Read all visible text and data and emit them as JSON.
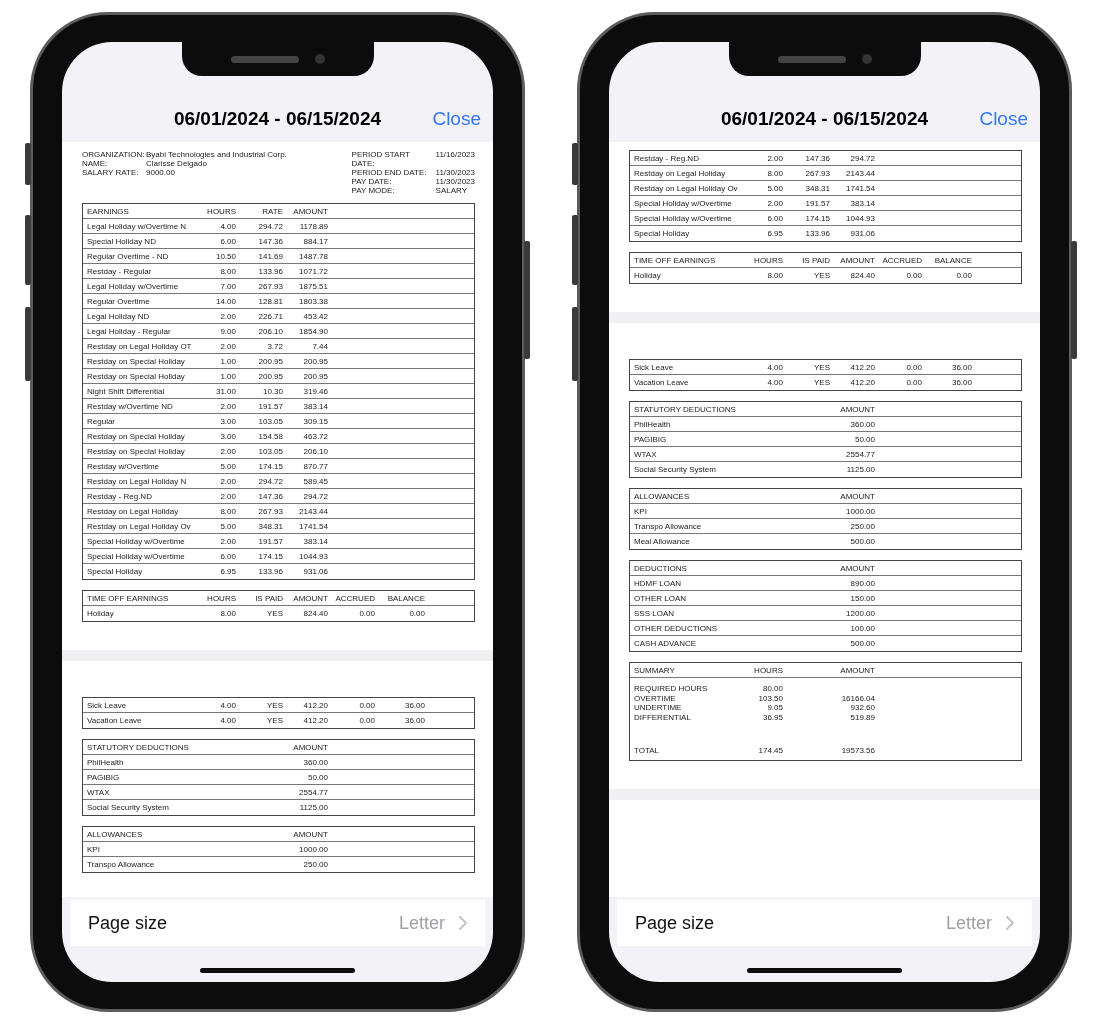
{
  "phones": [
    {
      "title": "06/01/2024 - 06/15/2024",
      "close_label": "Close",
      "page_size": {
        "label": "Page size",
        "value": "Letter"
      },
      "document": [
        {
          "kind": "info",
          "left": [
            {
              "label": "ORGANIZATION:",
              "value": "Byabi Technologies and Industrial Corp."
            },
            {
              "label": "NAME:",
              "value": "Clarisse Delgado"
            },
            {
              "label": "SALARY RATE:",
              "value": "9000.00"
            }
          ],
          "right": [
            {
              "label": "PERIOD START DATE:",
              "value": "11/16/2023"
            },
            {
              "label": "PERIOD END DATE:",
              "value": "11/30/2023"
            },
            {
              "label": "PAY DATE:",
              "value": "11/30/2023"
            },
            {
              "label": "PAY MODE:",
              "value": "SALARY"
            }
          ]
        },
        {
          "kind": "table",
          "columns": [
            "EARNINGS",
            "HOURS",
            "RATE",
            "AMOUNT"
          ],
          "rows": [
            [
              "Legal Holiday w/Overtime N",
              "4.00",
              "294.72",
              "1178.89"
            ],
            [
              "Special Holiday ND",
              "6.00",
              "147.36",
              "884.17"
            ],
            [
              "Regular Overtime - ND",
              "10.50",
              "141.69",
              "1487.78"
            ],
            [
              "Restday - Regular",
              "8.00",
              "133.96",
              "1071.72"
            ],
            [
              "Legal Holiday w/Overtime",
              "7.00",
              "267.93",
              "1875.51"
            ],
            [
              "Regular Overtime",
              "14.00",
              "128.81",
              "1803.38"
            ],
            [
              "Legal Holiday ND",
              "2.00",
              "226.71",
              "453.42"
            ],
            [
              "Legal Holiday - Regular",
              "9.00",
              "206.10",
              "1854.90"
            ],
            [
              "Restday on Legal Holiday OT",
              "2.00",
              "3.72",
              "7.44"
            ],
            [
              "Restday on Special Holiday",
              "1.00",
              "200.95",
              "200.95"
            ],
            [
              "Restday on Special Holiday",
              "1.00",
              "200.95",
              "200.95"
            ],
            [
              "Night Shift Differential",
              "31.00",
              "10.30",
              "319.46"
            ],
            [
              "Restday w/Overtime ND",
              "2.00",
              "191.57",
              "383.14"
            ],
            [
              "Regular",
              "3.00",
              "103.05",
              "309.15"
            ],
            [
              "Restday on Special Holiday",
              "3.00",
              "154.58",
              "463.72"
            ],
            [
              "Restday on Special Holiday",
              "2.00",
              "103.05",
              "206.10"
            ],
            [
              "Restday w/Overtime",
              "5.00",
              "174.15",
              "870.77"
            ],
            [
              "Restday on Legal Holiday N",
              "2.00",
              "294.72",
              "589.45"
            ],
            [
              "Restday - Reg.ND",
              "2.00",
              "147.36",
              "294.72"
            ],
            [
              "Restday on Legal Holiday",
              "8.00",
              "267.93",
              "2143.44"
            ],
            [
              "Restday on Legal Holiday Ov",
              "5.00",
              "348.31",
              "1741.54"
            ],
            [
              "Special Holiday w/Overtime",
              "2.00",
              "191.57",
              "383.14"
            ],
            [
              "Special Holiday w/Overtime",
              "6.00",
              "174.15",
              "1044.93"
            ],
            [
              "Special Holiday",
              "6.95",
              "133.96",
              "931.06"
            ]
          ]
        },
        {
          "kind": "table",
          "columns": [
            "TIME OFF EARNINGS",
            "HOURS",
            "IS PAID",
            "AMOUNT",
            "ACCRUED",
            "BALANCE"
          ],
          "rows": [
            [
              "Holiday",
              "8.00",
              "YES",
              "824.40",
              "0.00",
              "0.00"
            ]
          ]
        },
        {
          "kind": "page_break"
        },
        {
          "kind": "table",
          "rows": [
            [
              "Sick Leave",
              "4.00",
              "YES",
              "412.20",
              "0.00",
              "36.00"
            ],
            [
              "Vacation Leave",
              "4.00",
              "YES",
              "412.20",
              "0.00",
              "36.00"
            ]
          ]
        },
        {
          "kind": "table",
          "columns": [
            "STATUTORY DEDUCTIONS",
            "AMOUNT"
          ],
          "rows": [
            [
              "PhilHealth",
              "360.00"
            ],
            [
              "PAGIBIG",
              "50.00"
            ],
            [
              "WTAX",
              "2554.77"
            ],
            [
              "Social Security System",
              "1125.00"
            ]
          ]
        },
        {
          "kind": "table",
          "columns": [
            "ALLOWANCES",
            "AMOUNT"
          ],
          "rows": [
            [
              "KPI",
              "1000.00"
            ],
            [
              "Transpo Allowance",
              "250.00"
            ]
          ]
        }
      ]
    },
    {
      "title": "06/01/2024 - 06/15/2024",
      "close_label": "Close",
      "page_size": {
        "label": "Page size",
        "value": "Letter"
      },
      "document": [
        {
          "kind": "table",
          "rows": [
            [
              "Restday - Reg.ND",
              "2.00",
              "147.36",
              "294.72"
            ],
            [
              "Restday on Legal Holiday",
              "8.00",
              "267.93",
              "2143.44"
            ],
            [
              "Restday on Legal Holiday Ov",
              "5.00",
              "348.31",
              "1741.54"
            ],
            [
              "Special Holiday w/Overtime",
              "2.00",
              "191.57",
              "383.14"
            ],
            [
              "Special Holiday w/Overtime",
              "6.00",
              "174.15",
              "1044.93"
            ],
            [
              "Special Holiday",
              "6.95",
              "133.96",
              "931.06"
            ]
          ]
        },
        {
          "kind": "table",
          "columns": [
            "TIME OFF EARNINGS",
            "HOURS",
            "IS PAID",
            "AMOUNT",
            "ACCRUED",
            "BALANCE"
          ],
          "rows": [
            [
              "Holiday",
              "8.00",
              "YES",
              "824.40",
              "0.00",
              "0.00"
            ]
          ]
        },
        {
          "kind": "page_break"
        },
        {
          "kind": "table",
          "rows": [
            [
              "Sick Leave",
              "4.00",
              "YES",
              "412.20",
              "0.00",
              "36.00"
            ],
            [
              "Vacation Leave",
              "4.00",
              "YES",
              "412.20",
              "0.00",
              "36.00"
            ]
          ]
        },
        {
          "kind": "table",
          "columns": [
            "STATUTORY DEDUCTIONS",
            "AMOUNT"
          ],
          "rows": [
            [
              "PhilHealth",
              "360.00"
            ],
            [
              "PAGIBIG",
              "50.00"
            ],
            [
              "WTAX",
              "2554.77"
            ],
            [
              "Social Security System",
              "1125.00"
            ]
          ]
        },
        {
          "kind": "table",
          "columns": [
            "ALLOWANCES",
            "AMOUNT"
          ],
          "rows": [
            [
              "KPI",
              "1000.00"
            ],
            [
              "Transpo Allowance",
              "250.00"
            ],
            [
              "Meal Allowance",
              "500.00"
            ]
          ]
        },
        {
          "kind": "table",
          "columns": [
            "DEDUCTIONS",
            "AMOUNT"
          ],
          "rows": [
            [
              "HDMF LOAN",
              "890.00"
            ],
            [
              "OTHER LOAN",
              "150.00"
            ],
            [
              "SSS LOAN",
              "1200.00"
            ],
            [
              "OTHER DEDUCTIONS",
              "100.00"
            ],
            [
              "CASH ADVANCE",
              "500.00"
            ]
          ]
        },
        {
          "kind": "summary",
          "columns": [
            "SUMMARY",
            "HOURS",
            "AMOUNT"
          ],
          "rows": [
            [
              "REQUIRED HOURS",
              "80.00",
              null
            ],
            [
              "OVERTIME",
              "103.50",
              "16166.04"
            ],
            [
              "UNDERTIME",
              "9.05",
              "932.60"
            ],
            [
              "DIFFERENTIAL",
              "36.95",
              "519.89"
            ]
          ],
          "total": [
            "TOTAL",
            "174.45",
            "19573.56"
          ]
        },
        {
          "kind": "page_break"
        }
      ]
    }
  ]
}
